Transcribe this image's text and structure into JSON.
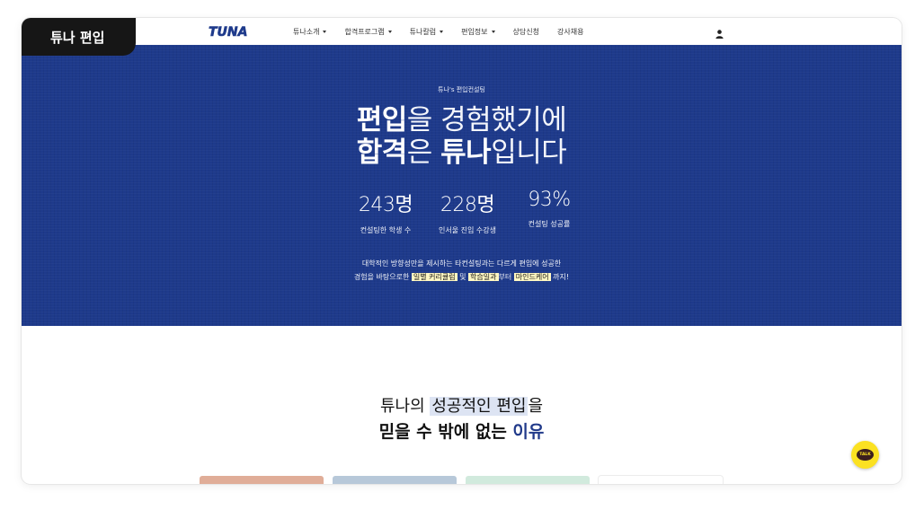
{
  "brand": {
    "tab_label": "튜나 편입",
    "logo_text": "TUNA"
  },
  "nav": {
    "items": [
      {
        "label": "튜나소개",
        "dropdown": true
      },
      {
        "label": "합격프로그램",
        "dropdown": true
      },
      {
        "label": "튜나칼럼",
        "dropdown": true
      },
      {
        "label": "편입정보",
        "dropdown": true
      },
      {
        "label": "상담신청",
        "dropdown": false
      },
      {
        "label": "강사채용",
        "dropdown": false
      }
    ],
    "user_icon": "user-icon"
  },
  "hero": {
    "eyebrow": "튜나's 편입컨설팅",
    "line1_bold": "편입",
    "line1_rest": "을 경험했기에",
    "line2_bold1": "합격",
    "line2_mid": "은 ",
    "line2_bold2": "튜나",
    "line2_rest": "입니다",
    "stats": [
      {
        "value": "243명",
        "label": "컨설팅한 학생 수"
      },
      {
        "value": "228명",
        "label": "인서울 진입 수강생"
      },
      {
        "value": "93%",
        "label": "컨설팅 성공률"
      }
    ],
    "desc_line1": "대학적인 방향성만을 제시하는 타컨설팅과는 다르게 편입에 성공한",
    "desc_line2_a": "경험을 바탕으로한 ",
    "desc_hl1": "일별 커리큘럼",
    "desc_line2_b": " 및 ",
    "desc_hl2": "학습일과",
    "desc_line2_c": "부터 ",
    "desc_hl3": "마인드케어",
    "desc_line2_d": " 까지!"
  },
  "why": {
    "line1_a": "튜나의 ",
    "line1_mark": "성공적인 편입",
    "line1_b": "을",
    "line2_a": "믿을 수 밖에 없는 ",
    "line2_blue": "이유"
  },
  "talk_button": {
    "label": "TALK"
  },
  "colors": {
    "hero_bg": "#1e3a8b",
    "highlight": "#fff7c2",
    "kakao_yellow": "#fbe122",
    "accent_blue": "#213a8a"
  }
}
